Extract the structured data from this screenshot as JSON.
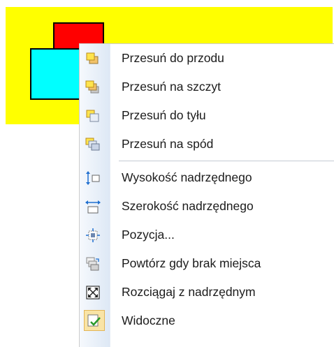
{
  "colors": {
    "canvas_background": "#ffff00",
    "front_shape": "#ff0000",
    "back_shape": "#00ffff",
    "checked_highlight": "#f9e4a6"
  },
  "context_menu": {
    "items": [
      {
        "label": "Przesuń do przodu",
        "icon": "bring-forward-icon"
      },
      {
        "label": "Przesuń na szczyt",
        "icon": "bring-to-front-icon"
      },
      {
        "label": "Przesuń do tyłu",
        "icon": "send-backward-icon"
      },
      {
        "label": "Przesuń na spód",
        "icon": "send-to-back-icon"
      },
      {
        "label": "Wysokość nadrzędnego",
        "icon": "fit-parent-height-icon"
      },
      {
        "label": "Szerokość nadrzędnego",
        "icon": "fit-parent-width-icon"
      },
      {
        "label": "Pozycja...",
        "icon": "position-icon"
      },
      {
        "label": "Powtórz gdy brak miejsca",
        "icon": "repeat-overflow-icon"
      },
      {
        "label": "Rozciągaj z nadrzędnym",
        "icon": "stretch-with-parent-icon"
      },
      {
        "label": "Widoczne",
        "icon": "visible-check-icon",
        "checked": true
      }
    ]
  }
}
